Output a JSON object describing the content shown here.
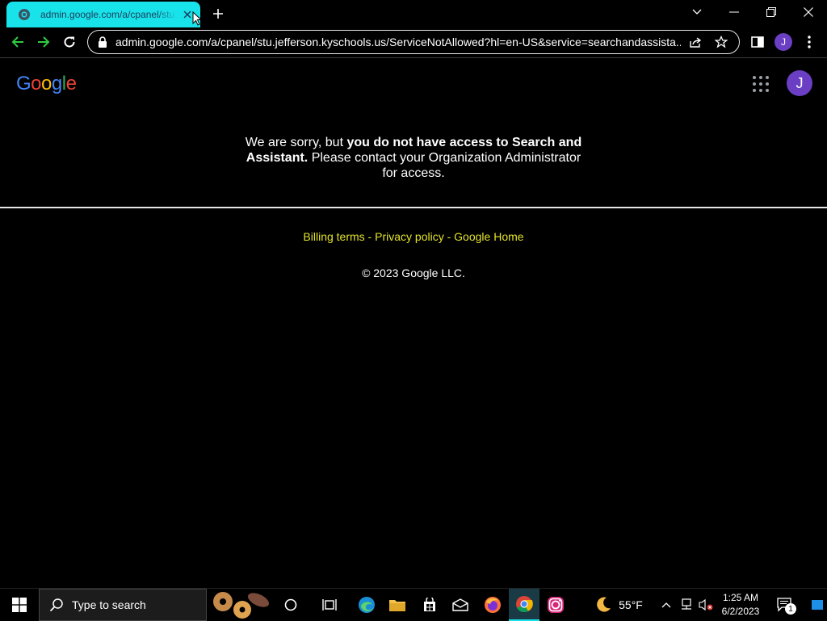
{
  "browser": {
    "tab": {
      "title": "admin.google.com/a/cpanel/stu.jefferson.kyschools.us"
    },
    "url": "admin.google.com/a/cpanel/stu.jefferson.kyschools.us/ServiceNotAllowed?hl=en-US&service=searchandassista...",
    "profile_initial": "J"
  },
  "page": {
    "logo_letters": [
      "G",
      "o",
      "o",
      "g",
      "l",
      "e"
    ],
    "logo_colors": [
      "#4285F4",
      "#EA4335",
      "#FBBC05",
      "#4285F4",
      "#34A853",
      "#EA4335"
    ],
    "avatar_initial": "J",
    "message": {
      "part1": "We are sorry, but ",
      "bold": "you do not have access to Search and Assistant.",
      "part2": " Please contact your Organization Administrator for access."
    },
    "footer": {
      "billing": "Billing terms",
      "privacy": "Privacy policy",
      "home": "Google Home",
      "separator": " - ",
      "copyright": "© 2023 Google LLC."
    }
  },
  "taskbar": {
    "search_placeholder": "Type to search",
    "weather_temp": "55°F",
    "time": "1:25 AM",
    "date": "6/2/2023",
    "notification_count": "1"
  }
}
